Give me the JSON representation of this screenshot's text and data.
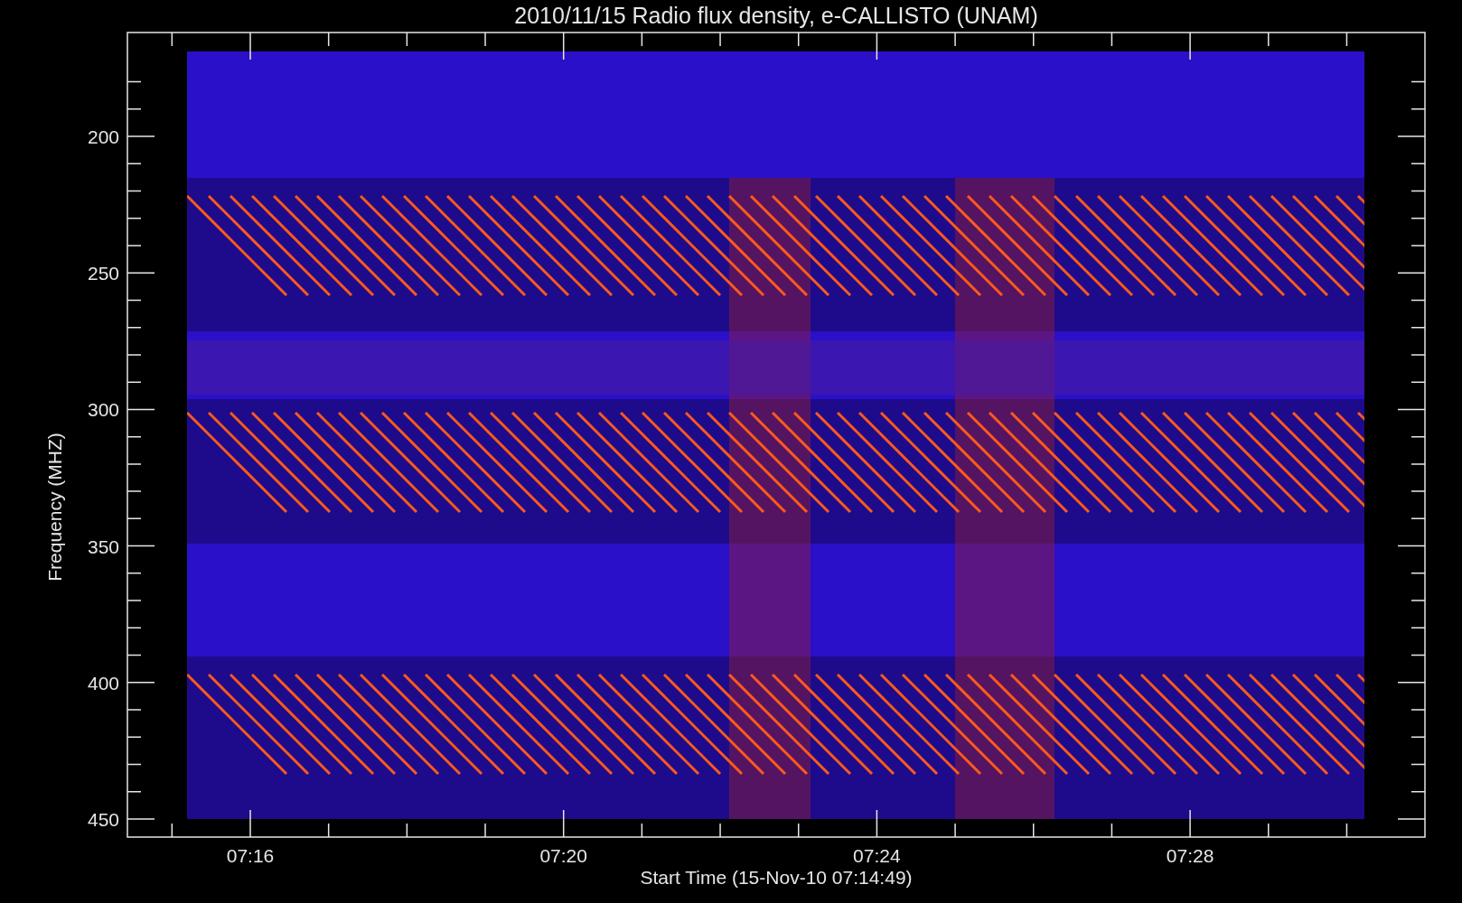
{
  "title": "2010/11/15  Radio flux density, e-CALLISTO (UNAM)",
  "y_axis": {
    "label": "Frequency (MHZ)",
    "ticks": [
      "200",
      "250",
      "300",
      "350",
      "400",
      "450"
    ]
  },
  "x_axis": {
    "label": "Start Time (15-Nov-10 07:14:49)",
    "ticks": [
      "07:16",
      "07:20",
      "07:24",
      "07:28"
    ]
  }
}
